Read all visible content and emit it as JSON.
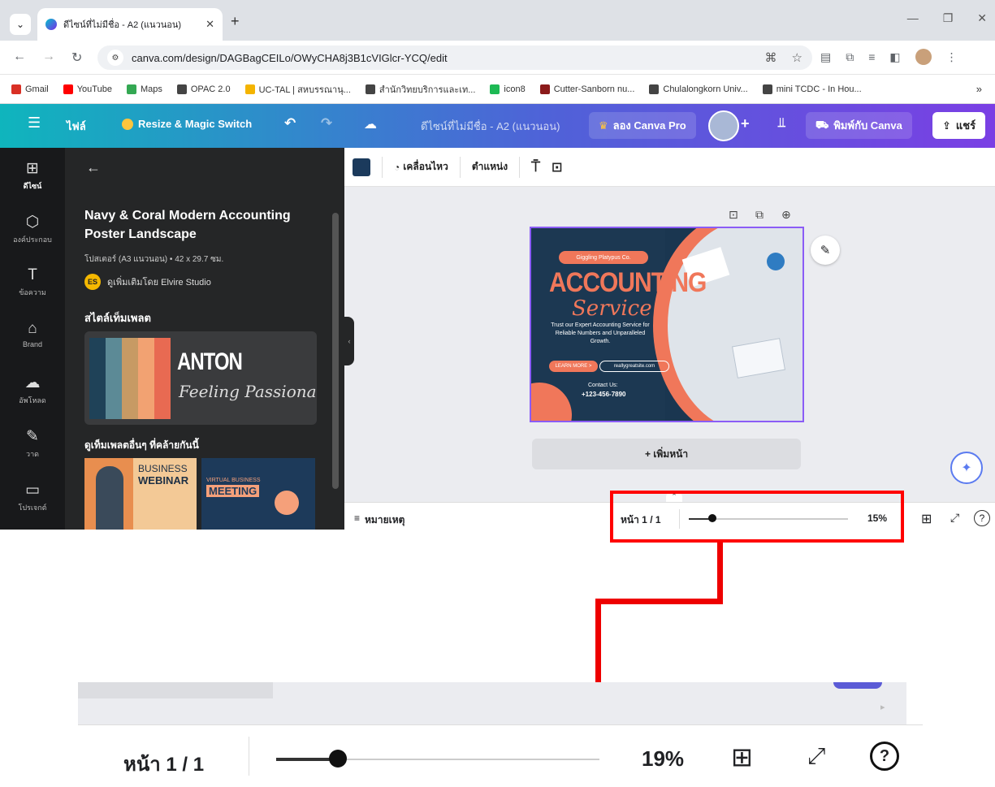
{
  "browser": {
    "tab_title": "ดีไซน์ที่ไม่มีชื่อ - A2 (แนวนอน)",
    "url": "canva.com/design/DAGBagCEILo/OWyCHA8j3B1cVIGlcr-YCQ/edit",
    "bookmarks": [
      {
        "label": "Gmail",
        "color": "#d93025"
      },
      {
        "label": "YouTube",
        "color": "#ff0000"
      },
      {
        "label": "Maps",
        "color": "#34a853"
      },
      {
        "label": "OPAC 2.0",
        "color": "#444444"
      },
      {
        "label": "UC-TAL | สหบรรณานุ...",
        "color": "#f4b400"
      },
      {
        "label": "สำนักวิทยบริการและเท...",
        "color": "#444444"
      },
      {
        "label": "icon8",
        "color": "#1db954"
      },
      {
        "label": "Cutter-Sanborn nu...",
        "color": "#8b1a1a"
      },
      {
        "label": "Chulalongkorn Univ...",
        "color": "#444444"
      },
      {
        "label": "mini TCDC - In Hou...",
        "color": "#444444"
      }
    ],
    "bookmarks_more": "»"
  },
  "canva_header": {
    "menu_icon": "☰",
    "file": "ไฟล์",
    "resize": "Resize & Magic Switch",
    "design_title": "ดีไซน์ที่ไม่มีชื่อ - A2 (แนวนอน)",
    "try_pro": "ลอง Canva Pro",
    "print": "พิมพ์กับ Canva",
    "share": "แชร์"
  },
  "rail": [
    {
      "label": "ดีไซน์",
      "glyph": "⊞"
    },
    {
      "label": "องค์ประกอบ",
      "glyph": "⬡"
    },
    {
      "label": "ข้อความ",
      "glyph": "T"
    },
    {
      "label": "Brand",
      "glyph": "⌂"
    },
    {
      "label": "อัพโหลด",
      "glyph": "☁"
    },
    {
      "label": "วาด",
      "glyph": "✎"
    },
    {
      "label": "โปรเจกต์",
      "glyph": "▭"
    }
  ],
  "panel": {
    "back": "←",
    "template_title": "Navy & Coral Modern Accounting Poster Landscape",
    "template_meta": "โปสเตอร์ (A3 แนวนอน) • 42 x 29.7 ซม.",
    "creator_initials": "ES",
    "creator_text": "ดูเพิ่มเติมโดย Elvire Studio",
    "style_heading": "สไตล์เท็มเพลต",
    "style_font_main": "ANTON",
    "style_font_sub": "Feeling Passionate",
    "palette": [
      "#1f4258",
      "#5c8a96",
      "#c79a64",
      "#f2a272",
      "#e86a52"
    ],
    "similar_heading": "ดูเท็มเพลตอื่นๆ ที่คล้ายกันนี้",
    "similar1_title": "BUSINESS",
    "similar1_sub": "WEBINAR",
    "similar2_kicker": "VIRTUAL BUSINESS",
    "similar2_title": "MEETING"
  },
  "toolbar": {
    "animate": "เคลื่อนไหว",
    "position": "ตำแหน่ง"
  },
  "poster": {
    "brand": "Giggling Platypus Co.",
    "title": "ACCOUNTING",
    "script": "Service",
    "body": "Trust our Expert Accounting Service for Reliable Numbers and Unparalleled Growth.",
    "cta": "LEARN MORE >",
    "site": "reallygreatsite.com",
    "contact_label": "Contact Us:",
    "phone": "+123-456-7890"
  },
  "add_page": "+ เพิ่มหน้า",
  "bottom": {
    "notes": "หมายเหตุ",
    "page": "หน้า 1 / 1",
    "zoom": "15%",
    "zoom_level": 0.15
  },
  "zoom_detail": {
    "page": "หน้า 1 / 1",
    "zoom": "19%",
    "zoom_level": 0.19
  }
}
